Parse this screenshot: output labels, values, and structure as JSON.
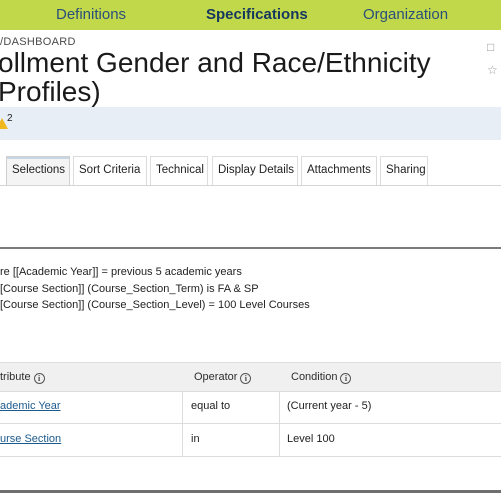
{
  "nav": {
    "items": [
      {
        "label": "Definitions"
      },
      {
        "label": "Specifications"
      },
      {
        "label": "Organization"
      }
    ]
  },
  "breadcrumb": "/DASHBOARD",
  "title": {
    "line1": "ollment Gender and Race/Ethnicity",
    "line2": "Profiles)"
  },
  "alert": {
    "count": "2"
  },
  "tabs": [
    {
      "label": "Selections"
    },
    {
      "label": "Sort Criteria"
    },
    {
      "label": "Technical"
    },
    {
      "label": "Display Details"
    },
    {
      "label": "Attachments"
    },
    {
      "label": "Sharing"
    }
  ],
  "summary": [
    "re [[Academic Year]] = previous 5 academic years",
    "[Course Section]] (Course_Section_Term) is FA & SP",
    "[Course Section]] (Course_Section_Level) = 100 Level Courses"
  ],
  "table": {
    "headers": {
      "attribute": "tribute",
      "operator": "Operator",
      "condition": "Condition"
    },
    "rows": [
      {
        "attribute": "ademic Year",
        "operator": "equal to",
        "condition": "(Current year - 5)"
      },
      {
        "attribute": "urse Section",
        "operator": "in",
        "condition": "Level 100"
      }
    ]
  },
  "colors": {
    "nav_bg": "#c0d84a",
    "nav_text": "#2a4f7a",
    "link": "#1c5a8c",
    "alert_bg": "#e8eef5",
    "warning": "#f0b81e"
  }
}
